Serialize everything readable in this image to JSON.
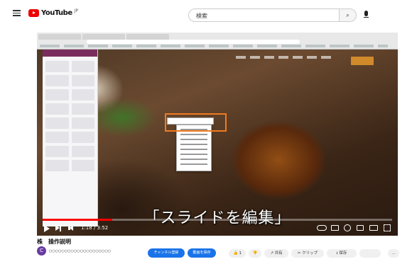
{
  "header": {
    "logo_text": "YouTube",
    "logo_sup": "JP",
    "search_value": "検索",
    "search_button_icon": "search-icon",
    "mic_icon": "mic-icon",
    "menu_icon": "hamburger-icon"
  },
  "video": {
    "subtitle": "「スライドを編集」",
    "progress_fraction": 0.2,
    "time": "1:18 / 3:52",
    "accent_color": "#ff0000",
    "highlight_color": "#f07b20"
  },
  "below": {
    "title": "株　操作説明",
    "channel_avatar": "C",
    "channel_text": "○○○○○○○○○○○○○○○○○○○○",
    "button_1": "チャンネル登録",
    "button_2": "動画を保存",
    "like": "👍 1",
    "dislike": "👎",
    "share": "↗ 共有",
    "clip": "✂ クリップ",
    "save": "⭳ 保存",
    "more": "…"
  }
}
